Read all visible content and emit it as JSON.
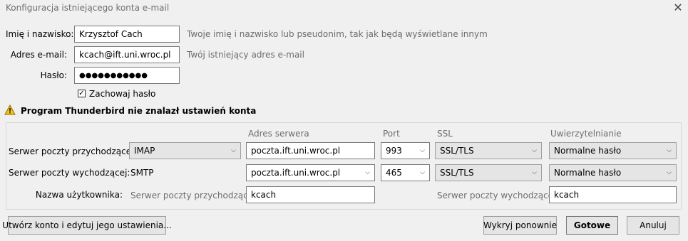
{
  "window": {
    "title": "Konfiguracja istniejącego konta e-mail",
    "close_glyph": "✕"
  },
  "form": {
    "name_label": "Imię i nazwisko:",
    "name_value": "Krzysztof Cach",
    "name_hint": "Twoje imię i nazwisko lub pseudonim, tak jak będą wyświetlane innym",
    "email_label": "Adres e-mail:",
    "email_value": "kcach@ift.uni.wroc.pl",
    "email_hint": "Twój istniejący adres e-mail",
    "password_label": "Hasło:",
    "password_value": "●●●●●●●●●●●",
    "remember_label": "Zachowaj hasło",
    "remember_checked": true
  },
  "warning": {
    "icon": "warning-icon",
    "text": "Program Thunderbird nie znalazł ustawień konta"
  },
  "servers": {
    "headers": {
      "address": "Adres serwera",
      "port": "Port",
      "ssl": "SSL",
      "auth": "Uwierzytelnianie"
    },
    "incoming": {
      "label": "Serwer poczty przychodzącej:",
      "protocol": "IMAP",
      "address": "poczta.ift.uni.wroc.pl",
      "port": "993",
      "ssl": "SSL/TLS",
      "auth": "Normalne hasło"
    },
    "outgoing": {
      "label": "Serwer poczty wychodzącej:",
      "protocol": "SMTP",
      "address": "poczta.ift.uni.wroc.pl",
      "port": "465",
      "ssl": "SSL/TLS",
      "auth": "Normalne hasło"
    },
    "username": {
      "label": "Nazwa użytkownika:",
      "incoming_label": "Serwer poczty przychodzącej:",
      "incoming_value": "kcach",
      "outgoing_label": "Serwer poczty wychodzącej:",
      "outgoing_value": "kcach"
    }
  },
  "buttons": {
    "create_edit": "Utwórz konto i edytuj jego ustawienia...",
    "retest": "Wykryj ponownie",
    "done": "Gotowe",
    "cancel": "Anuluj"
  }
}
